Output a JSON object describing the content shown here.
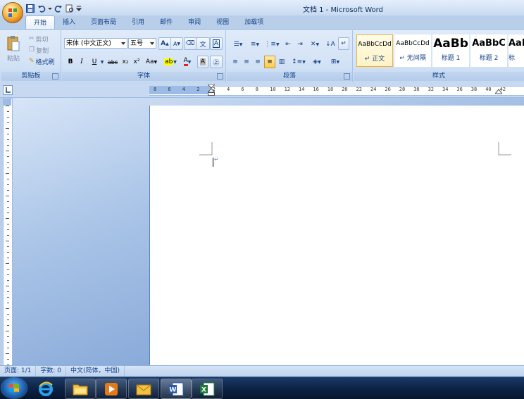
{
  "window": {
    "title": "文档 1 - Microsoft Word"
  },
  "tabs": [
    "开始",
    "插入",
    "页面布局",
    "引用",
    "邮件",
    "审阅",
    "视图",
    "加载项"
  ],
  "clipboard": {
    "paste": "粘贴",
    "cut": "剪切",
    "copy": "复制",
    "format_painter": "格式刷",
    "label": "剪贴板"
  },
  "font": {
    "name": "宋体 (中文正文)",
    "size": "五号",
    "label": "字体",
    "grow": "A",
    "shrink": "A",
    "bold": "B",
    "italic": "I",
    "underline": "U",
    "strike": "abc",
    "subscript": "x₂",
    "superscript": "x²",
    "change_case": "Aa"
  },
  "paragraph": {
    "label": "段落"
  },
  "styles": {
    "label": "样式",
    "items": [
      {
        "sample": "AaBbCcDd",
        "name": "↵ 正文"
      },
      {
        "sample": "AaBbCcDd",
        "name": "↵ 无间隔"
      },
      {
        "sample": "AaBb",
        "name": "标题 1"
      },
      {
        "sample": "AaBbC",
        "name": "标题 2"
      },
      {
        "sample": "AaB",
        "name": "标"
      }
    ]
  },
  "ruler": {
    "numbers": [
      "8",
      "6",
      "4",
      "2",
      "2",
      "4",
      "6",
      "8",
      "10",
      "12",
      "14",
      "16",
      "18",
      "20",
      "22",
      "24",
      "26",
      "28",
      "30",
      "32",
      "34",
      "36",
      "38",
      "40",
      "42"
    ]
  },
  "status": {
    "page": "页面: 1/1",
    "words": "字数: 0",
    "lang": "中文(简体，中国)"
  },
  "colors": {
    "accent": "#15428b",
    "ribbon": "#d4e3f6",
    "taskbar": "#0c2244"
  }
}
